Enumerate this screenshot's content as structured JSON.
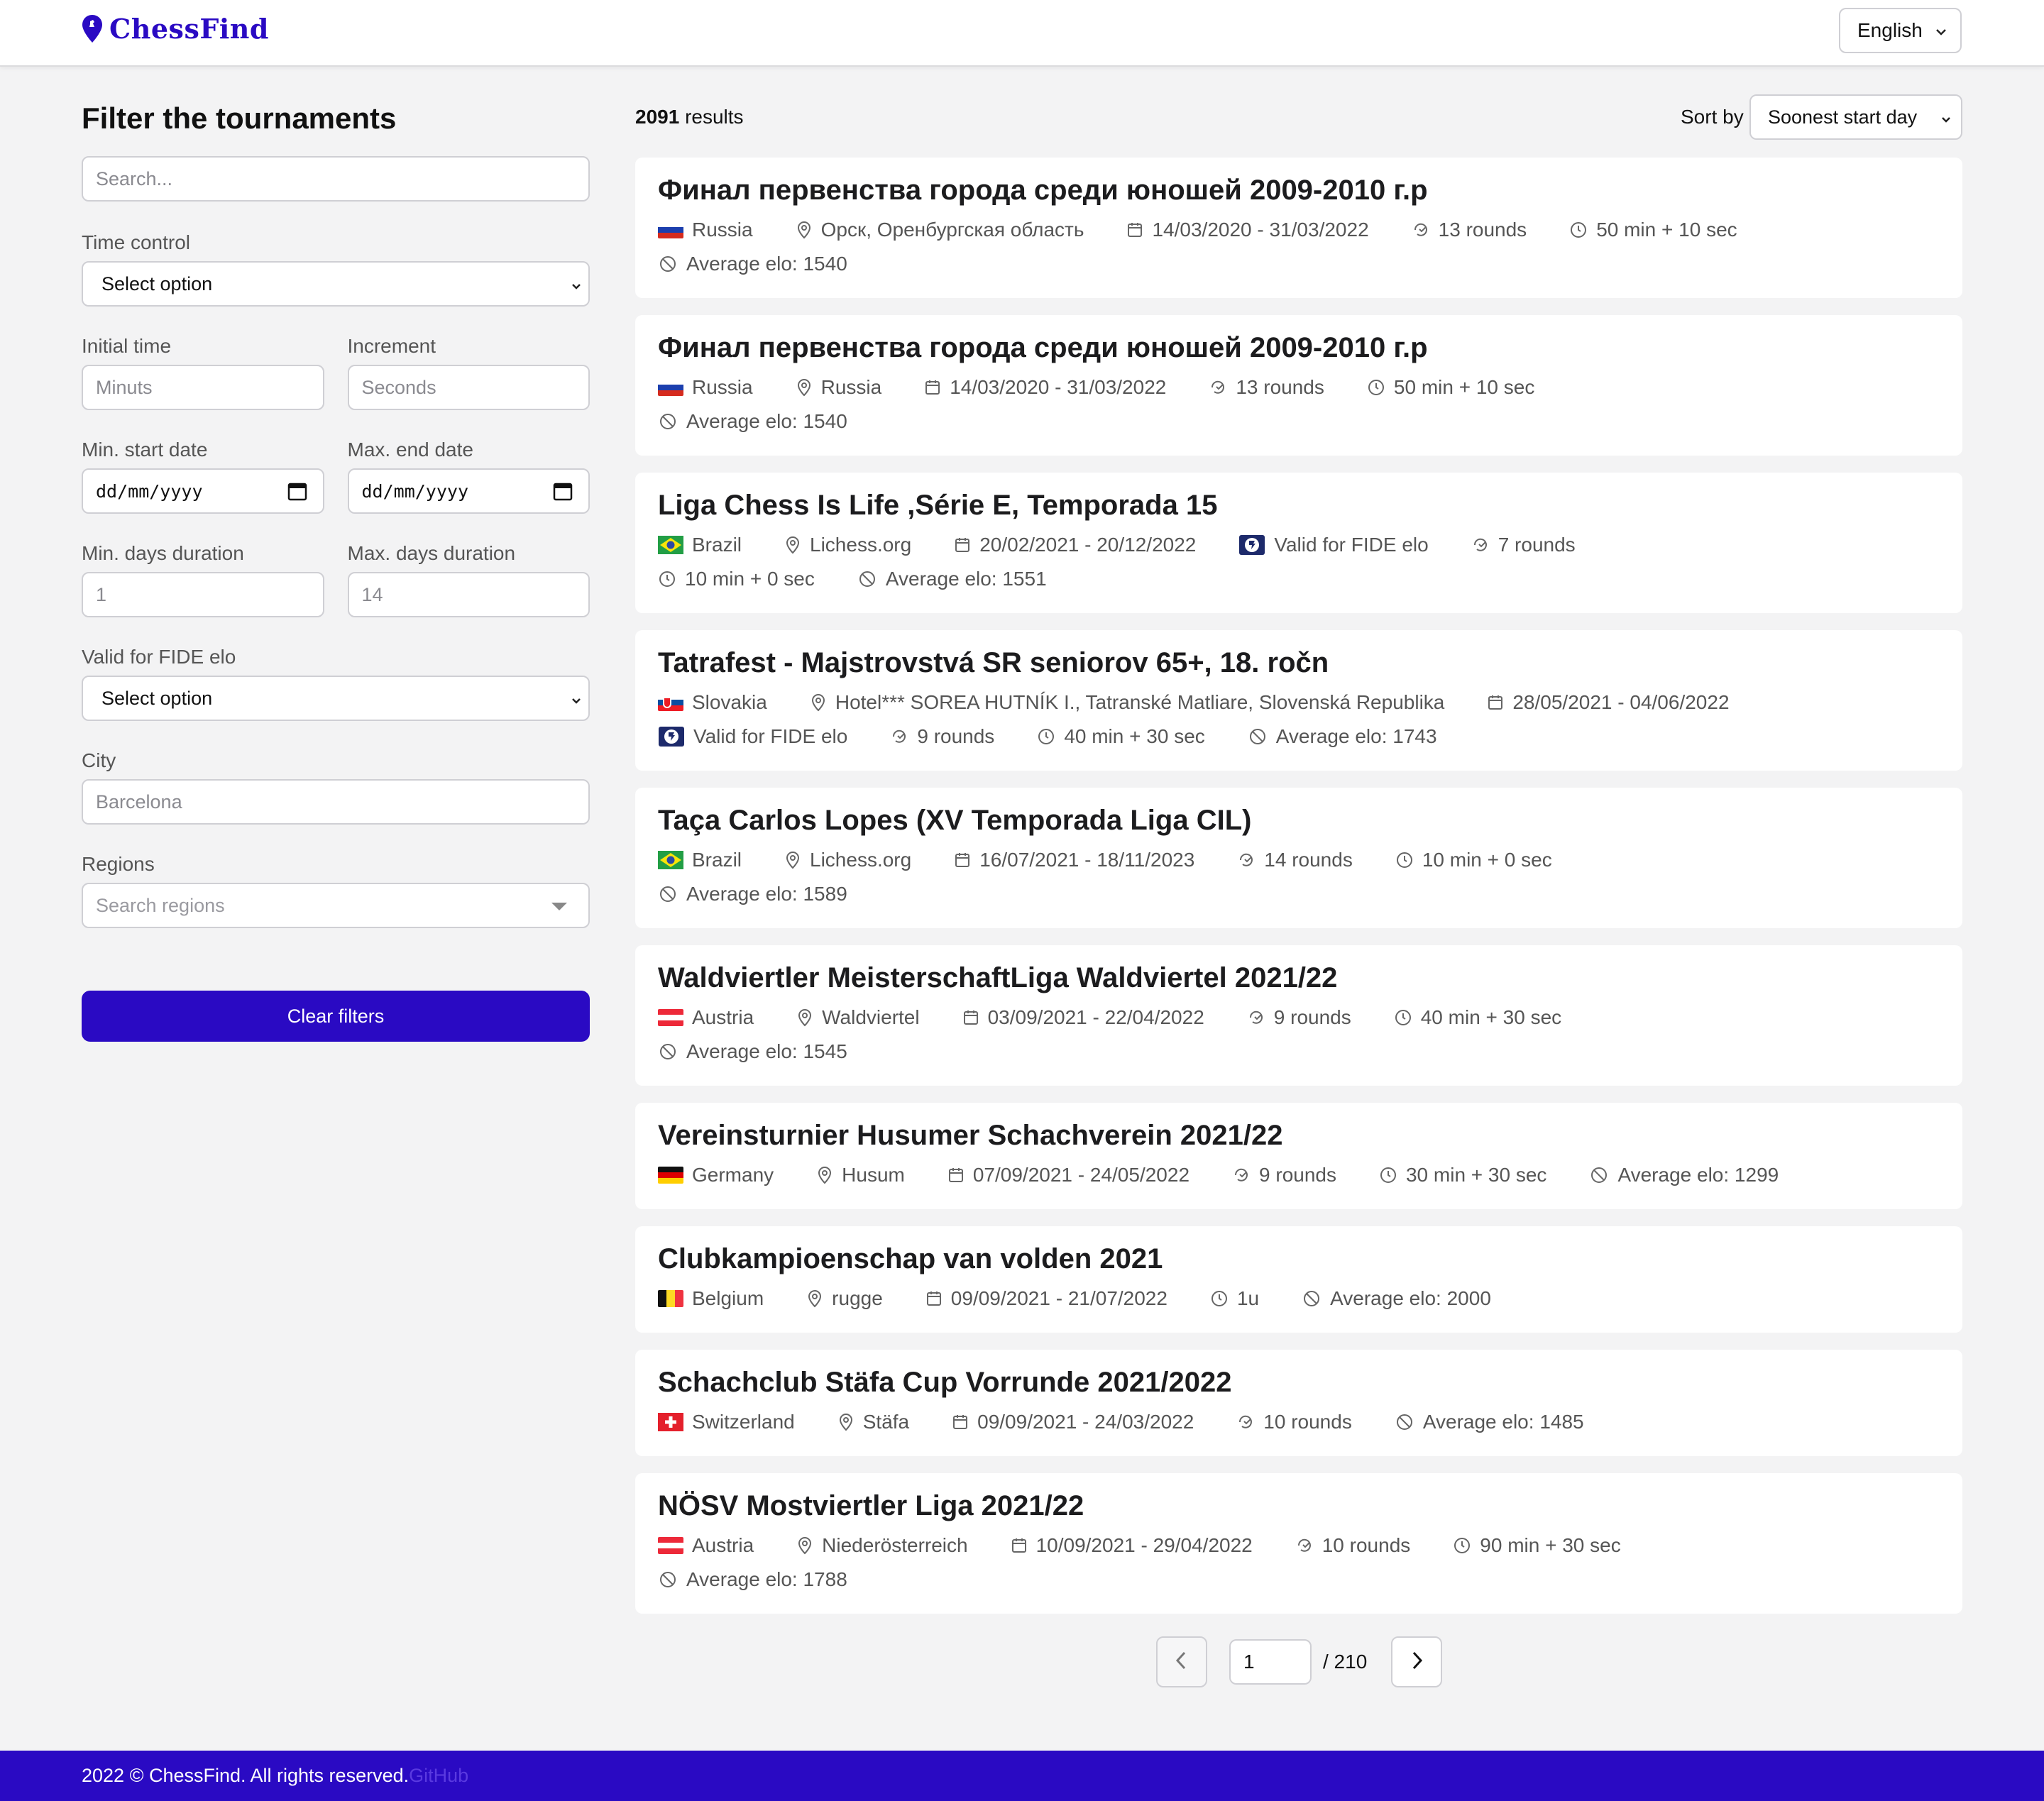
{
  "header": {
    "logo_text": "ChessFind",
    "language": "English"
  },
  "sidebar": {
    "title": "Filter the tournaments",
    "search_placeholder": "Search...",
    "time_control_label": "Time control",
    "time_control_value": "Select option",
    "initial_time_label": "Initial time",
    "initial_time_placeholder": "Minuts",
    "increment_label": "Increment",
    "increment_placeholder": "Seconds",
    "min_start_label": "Min. start date",
    "min_start_value": "dd/mm/yyyy",
    "max_end_label": "Max. end date",
    "max_end_value": "dd/mm/yyyy",
    "min_days_label": "Min. days duration",
    "min_days_placeholder": "1",
    "max_days_label": "Max. days duration",
    "max_days_placeholder": "14",
    "fide_label": "Valid for FIDE elo",
    "fide_value": "Select option",
    "city_label": "City",
    "city_placeholder": "Barcelona",
    "regions_label": "Regions",
    "regions_placeholder": "Search regions",
    "clear_button": "Clear filters"
  },
  "results": {
    "count": "2091",
    "count_suffix": "results",
    "sort_label": "Sort by",
    "sort_value": "Soonest start day"
  },
  "tournaments": [
    {
      "title": "Финал первенства города среди юношей 2009-2010 г.р",
      "rows": [
        [
          {
            "type": "flag",
            "flag": "russia",
            "text": "Russia"
          },
          {
            "type": "location",
            "text": "Орск, Оренбургская область"
          },
          {
            "type": "calendar",
            "text": "14/03/2020 - 31/03/2022"
          },
          {
            "type": "rounds",
            "text": "13 rounds"
          },
          {
            "type": "clock",
            "text": "50 min + 10 sec"
          }
        ],
        [
          {
            "type": "elo",
            "text": "Average elo: 1540"
          }
        ]
      ]
    },
    {
      "title": "Финал первенства города среди юношей 2009-2010 г.р",
      "rows": [
        [
          {
            "type": "flag",
            "flag": "russia",
            "text": "Russia"
          },
          {
            "type": "location",
            "text": "Russia"
          },
          {
            "type": "calendar",
            "text": "14/03/2020 - 31/03/2022"
          },
          {
            "type": "rounds",
            "text": "13 rounds"
          },
          {
            "type": "clock",
            "text": "50 min + 10 sec"
          }
        ],
        [
          {
            "type": "elo",
            "text": "Average elo: 1540"
          }
        ]
      ]
    },
    {
      "title": "Liga Chess Is Life ,Série E, Temporada 15",
      "rows": [
        [
          {
            "type": "flag",
            "flag": "brazil",
            "text": "Brazil"
          },
          {
            "type": "location",
            "text": "Lichess.org"
          },
          {
            "type": "calendar",
            "text": "20/02/2021 - 20/12/2022"
          },
          {
            "type": "fide",
            "text": "Valid for FIDE elo"
          },
          {
            "type": "rounds",
            "text": "7 rounds"
          }
        ],
        [
          {
            "type": "clock",
            "text": "10 min + 0 sec"
          },
          {
            "type": "elo",
            "text": "Average elo: 1551"
          }
        ]
      ]
    },
    {
      "title": "Tatrafest - Majstrovstvá SR seniorov 65+, 18. ročn",
      "rows": [
        [
          {
            "type": "flag",
            "flag": "slovakia",
            "text": "Slovakia"
          },
          {
            "type": "location",
            "text": "Hotel*** SOREA HUTNÍK I., Tatranské Matliare, Slovenská Republika"
          },
          {
            "type": "calendar",
            "text": "28/05/2021 - 04/06/2022"
          }
        ],
        [
          {
            "type": "fide",
            "text": "Valid for FIDE elo"
          },
          {
            "type": "rounds",
            "text": "9 rounds"
          },
          {
            "type": "clock",
            "text": "40 min + 30 sec"
          },
          {
            "type": "elo",
            "text": "Average elo: 1743"
          }
        ]
      ]
    },
    {
      "title": "Taça Carlos Lopes (XV Temporada Liga CIL)",
      "rows": [
        [
          {
            "type": "flag",
            "flag": "brazil",
            "text": "Brazil"
          },
          {
            "type": "location",
            "text": "Lichess.org"
          },
          {
            "type": "calendar",
            "text": "16/07/2021 - 18/11/2023"
          },
          {
            "type": "rounds",
            "text": "14 rounds"
          },
          {
            "type": "clock",
            "text": "10 min + 0 sec"
          }
        ],
        [
          {
            "type": "elo",
            "text": "Average elo: 1589"
          }
        ]
      ]
    },
    {
      "title": "Waldviertler MeisterschaftLiga Waldviertel 2021/22",
      "rows": [
        [
          {
            "type": "flag",
            "flag": "austria",
            "text": "Austria"
          },
          {
            "type": "location",
            "text": "Waldviertel"
          },
          {
            "type": "calendar",
            "text": "03/09/2021 - 22/04/2022"
          },
          {
            "type": "rounds",
            "text": "9 rounds"
          },
          {
            "type": "clock",
            "text": "40 min + 30 sec"
          }
        ],
        [
          {
            "type": "elo",
            "text": "Average elo: 1545"
          }
        ]
      ]
    },
    {
      "title": "Vereinsturnier Husumer Schachverein 2021/22",
      "rows": [
        [
          {
            "type": "flag",
            "flag": "germany",
            "text": "Germany"
          },
          {
            "type": "location",
            "text": "Husum"
          },
          {
            "type": "calendar",
            "text": "07/09/2021 - 24/05/2022"
          },
          {
            "type": "rounds",
            "text": "9 rounds"
          },
          {
            "type": "clock",
            "text": "30 min + 30 sec"
          },
          {
            "type": "elo",
            "text": "Average elo: 1299"
          }
        ]
      ]
    },
    {
      "title": "Clubkampioenschap van volden 2021",
      "rows": [
        [
          {
            "type": "flag",
            "flag": "belgium",
            "text": "Belgium"
          },
          {
            "type": "location",
            "text": "rugge"
          },
          {
            "type": "calendar",
            "text": "09/09/2021 - 21/07/2022"
          },
          {
            "type": "clock",
            "text": "1u"
          },
          {
            "type": "elo",
            "text": "Average elo: 2000"
          }
        ]
      ]
    },
    {
      "title": "Schachclub Stäfa Cup Vorrunde 2021/2022",
      "rows": [
        [
          {
            "type": "flag",
            "flag": "switzerland",
            "text": "Switzerland"
          },
          {
            "type": "location",
            "text": "Stäfa"
          },
          {
            "type": "calendar",
            "text": "09/09/2021 - 24/03/2022"
          },
          {
            "type": "rounds",
            "text": "10 rounds"
          },
          {
            "type": "elo",
            "text": "Average elo: 1485"
          }
        ]
      ]
    },
    {
      "title": "NÖSV Mostviertler Liga 2021/22",
      "rows": [
        [
          {
            "type": "flag",
            "flag": "austria",
            "text": "Austria"
          },
          {
            "type": "location",
            "text": "Niederösterreich"
          },
          {
            "type": "calendar",
            "text": "10/09/2021 - 29/04/2022"
          },
          {
            "type": "rounds",
            "text": "10 rounds"
          },
          {
            "type": "clock",
            "text": "90 min + 30 sec"
          }
        ],
        [
          {
            "type": "elo",
            "text": "Average elo: 1788"
          }
        ]
      ]
    }
  ],
  "pagination": {
    "page": "1",
    "total": "/ 210"
  },
  "footer": {
    "copyright": "2022 © ChessFind. All rights reserved.",
    "github": "GitHub"
  },
  "colors": {
    "brand": "#2a0ac3",
    "background": "#f3f3f4",
    "card": "#ffffff"
  }
}
